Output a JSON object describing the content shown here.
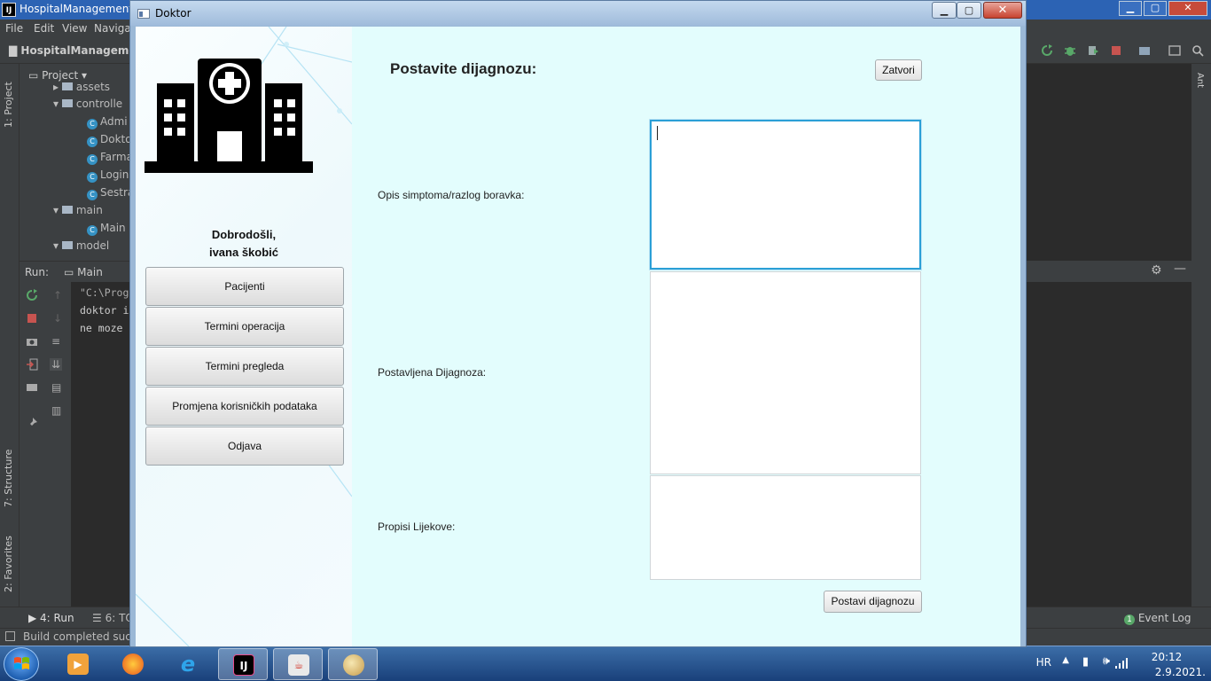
{
  "ide": {
    "title": "HospitalManagementS",
    "menu": [
      "File",
      "Edit",
      "View",
      "Naviga"
    ],
    "breadcrumb": "HospitalManagement",
    "project_label": "Project",
    "left_tabs": [
      "1: Project",
      "7: Structure",
      "2: Favorites"
    ],
    "right_tab": "Ant",
    "tree": [
      {
        "kind": "folder",
        "label": "assets",
        "level": 0
      },
      {
        "kind": "folder",
        "label": "controlle",
        "level": 0
      },
      {
        "kind": "class",
        "label": "Admi",
        "level": 1
      },
      {
        "kind": "class",
        "label": "Dokto",
        "level": 1
      },
      {
        "kind": "class",
        "label": "Farma",
        "level": 1
      },
      {
        "kind": "class",
        "label": "Login",
        "level": 1
      },
      {
        "kind": "class",
        "label": "Sestra",
        "level": 1
      },
      {
        "kind": "folder",
        "label": "main",
        "level": 0
      },
      {
        "kind": "class",
        "label": "Main",
        "level": 1
      },
      {
        "kind": "folder",
        "label": "model",
        "level": 0
      }
    ],
    "run_label": "Run:",
    "run_config": "Main",
    "console_lines": [
      "\"C:\\Prog",
      "doktor i",
      "ne moze "
    ],
    "bottom_tabs": [
      "4: Run",
      "6: TO"
    ],
    "event_log": "Event Log",
    "event_log_count": "1",
    "status_text": "Build completed succe"
  },
  "taskbar": {
    "apps": [
      "video-player",
      "firefox",
      "internet-explorer",
      "intellij",
      "java",
      "paint"
    ],
    "language": "HR",
    "time": "20:12",
    "date": "2.9.2021."
  },
  "window": {
    "title": "Doktor",
    "sidebar": {
      "welcome_line1": "Dobrodošli,",
      "welcome_line2": "ivana škobić",
      "nav": [
        "Pacijenti",
        "Termini operacija",
        "Termini pregleda",
        "Promjena korisničkih podataka",
        "Odjava"
      ]
    },
    "main": {
      "title": "Postavite dijagnozu:",
      "close_button": "Zatvori",
      "fields": [
        {
          "label": "Opis simptoma/razlog boravka:",
          "value": ""
        },
        {
          "label": "Postavljena Dijagnoza:",
          "value": ""
        },
        {
          "label": "Propisi Lijekove:",
          "value": ""
        }
      ],
      "submit_button": "Postavi dijagnozu"
    }
  }
}
